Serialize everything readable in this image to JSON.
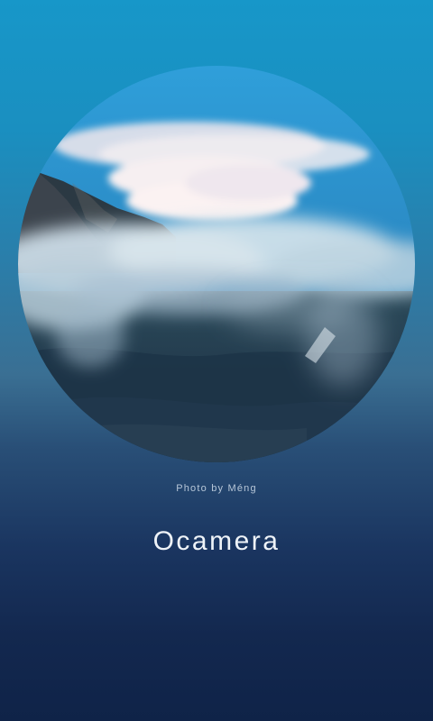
{
  "splash": {
    "photo": {
      "subject": "mountain-with-clouds",
      "colors": {
        "sky": "#2d9bd6",
        "mountain": "#1e3443",
        "cloud": "#f3eef1"
      }
    },
    "credit": "Photo by Méng",
    "app_name": "Ocamera",
    "colors": {
      "background_top": "#1797c9",
      "background_bottom": "#0f2348"
    }
  }
}
